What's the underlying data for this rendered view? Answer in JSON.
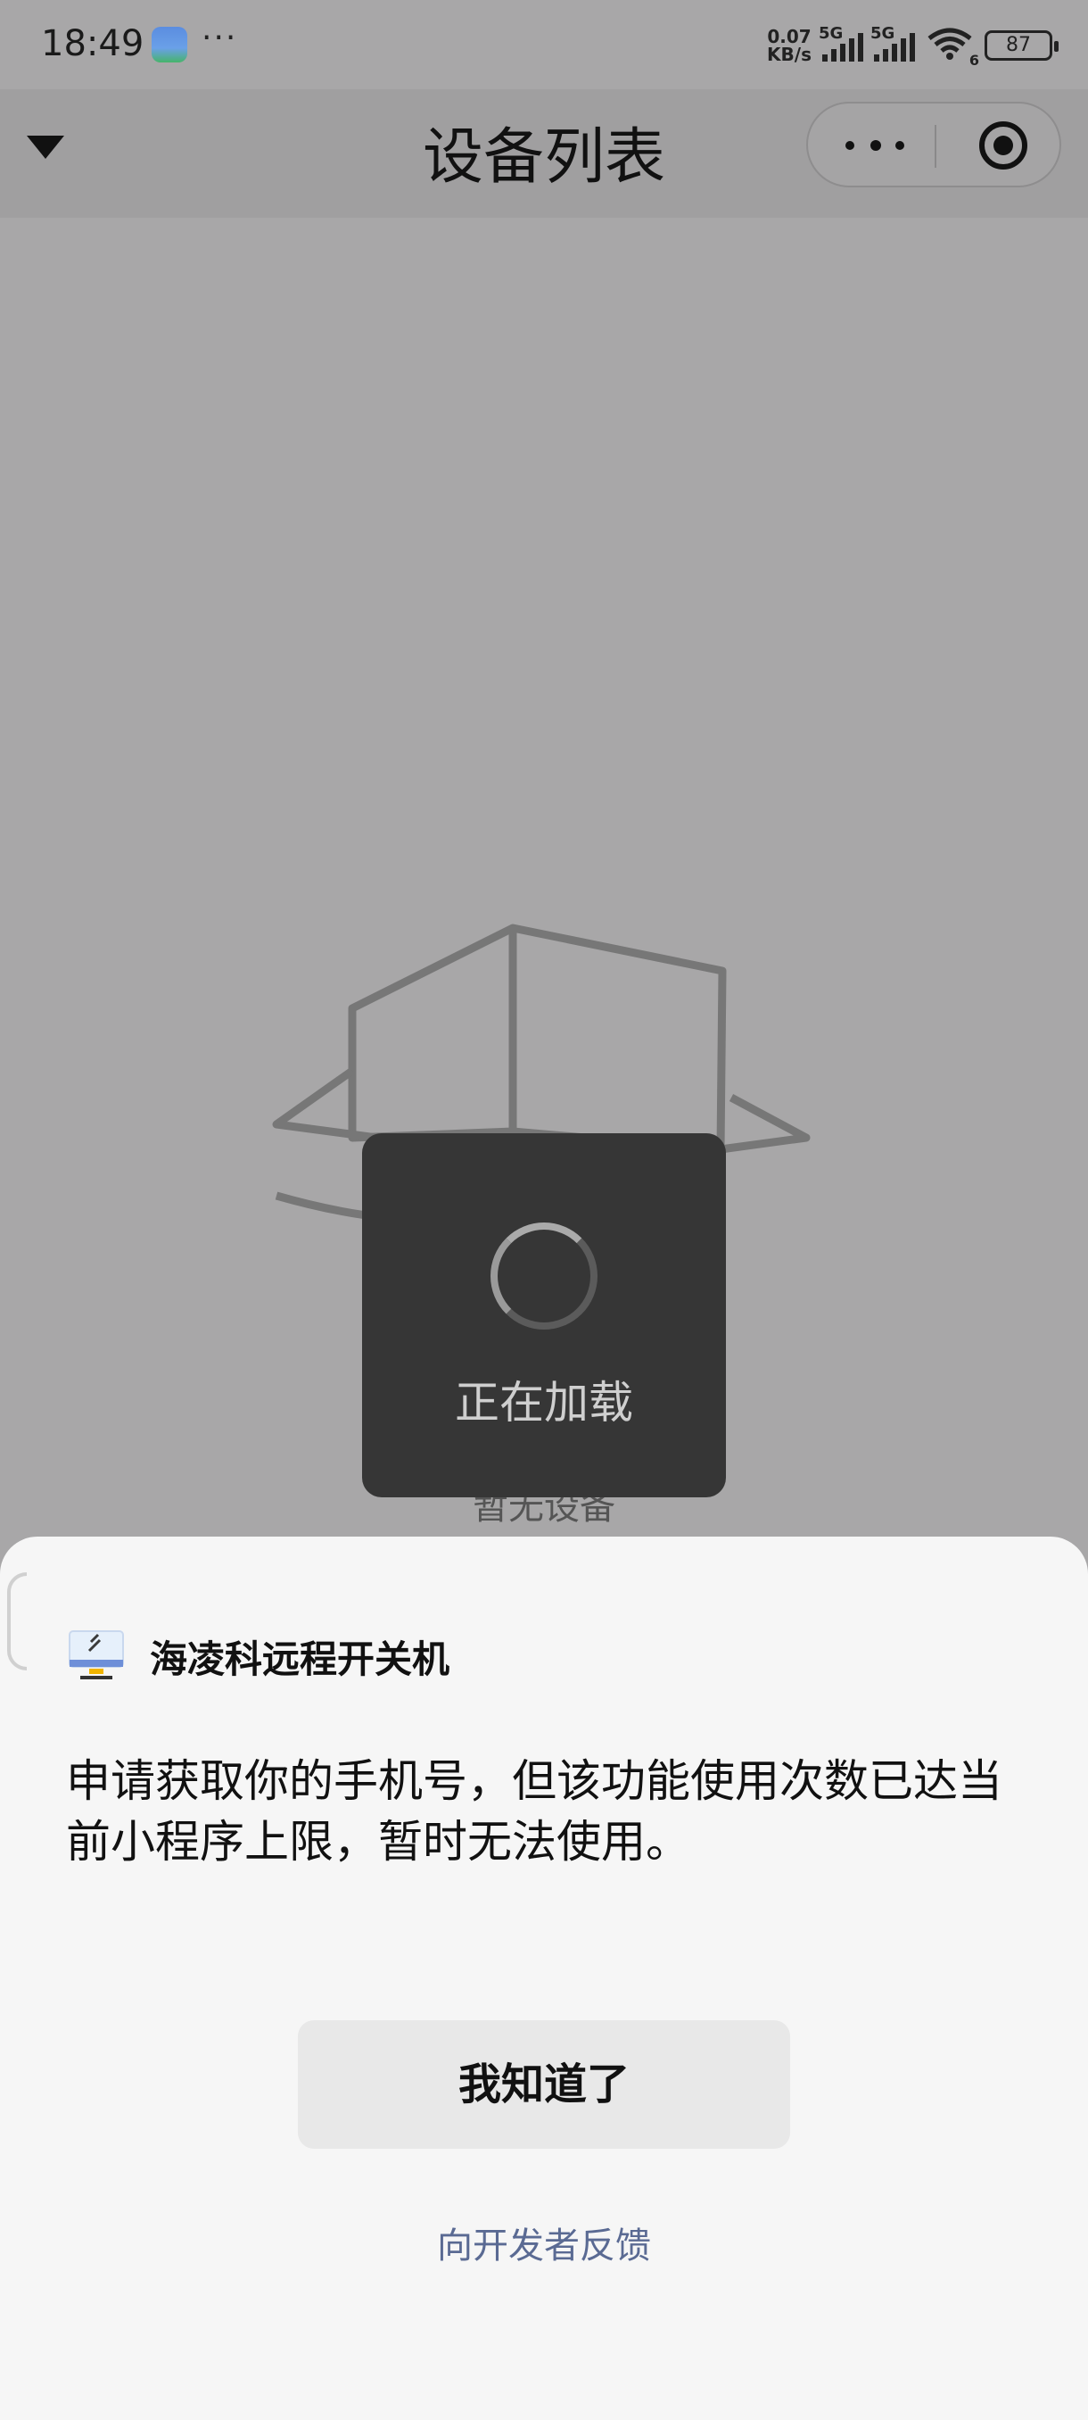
{
  "status_bar": {
    "time": "18:49",
    "more_dots": "···",
    "net_speed_value": "0.07",
    "net_speed_unit": "KB/s",
    "signal1_tag": "5G",
    "signal2_tag": "5G",
    "wifi_tag": "6",
    "battery": "87"
  },
  "nav": {
    "title": "设备列表"
  },
  "empty_state": {
    "text": "暂无设备"
  },
  "toast": {
    "text": "正在加载"
  },
  "sheet": {
    "app_name": "海凌科远程开关机",
    "message": "申请获取你的手机号，但该功能使用次数已达当前小程序上限，暂时无法使用。",
    "ok_label": "我知道了",
    "feedback_label": "向开发者反馈"
  },
  "colors": {
    "overlay_bg": "#a8a7a8",
    "toast_bg": "#363636",
    "sheet_bg": "#f6f6f6",
    "button_bg": "#e8e8e8",
    "link": "#5a6a93"
  },
  "icons": [
    "app-icon",
    "dropdown-arrow-icon",
    "more-icon",
    "target-icon",
    "empty-box-icon",
    "loading-spinner-icon",
    "mini-program-icon",
    "wifi-icon",
    "signal-icon",
    "battery-icon"
  ]
}
